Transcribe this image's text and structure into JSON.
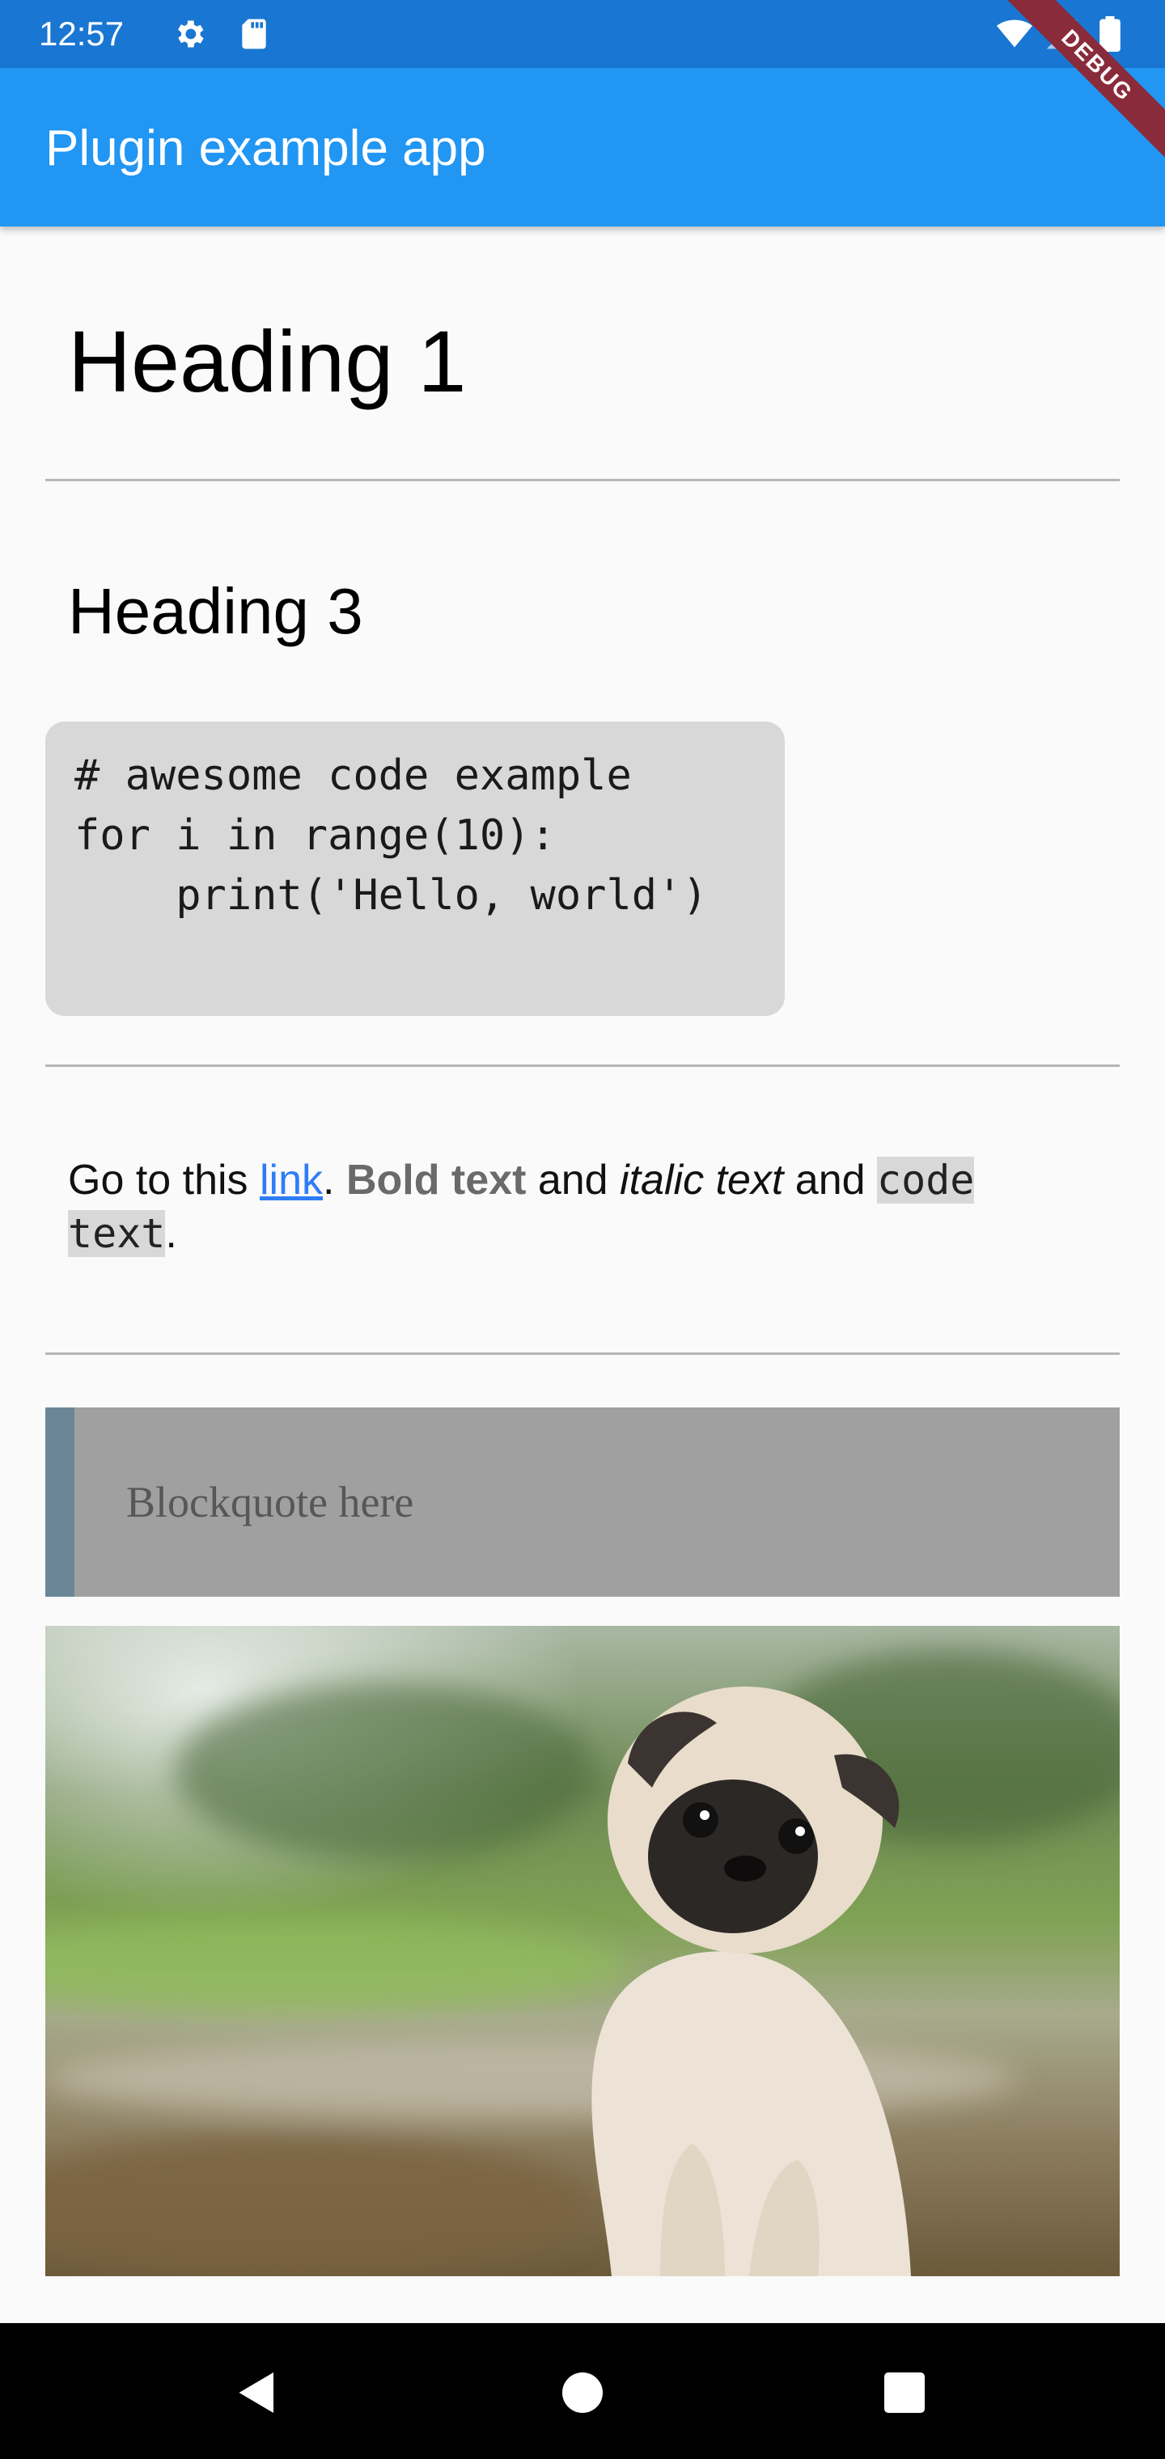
{
  "status_bar": {
    "time": "12:57",
    "icons": [
      "settings-icon",
      "sd-card-icon",
      "wifi-icon",
      "signal-icon",
      "battery-icon"
    ]
  },
  "app_bar": {
    "title": "Plugin example app",
    "debug_banner": "DEBUG"
  },
  "content": {
    "heading1": "Heading 1",
    "heading3": "Heading 3",
    "code_lines": [
      "# awesome code example",
      "for i in range(10):",
      "    print('Hello, world')"
    ],
    "paragraph": {
      "prefix": "Go to this ",
      "link": "link",
      "after_link": ". ",
      "bold": "Bold text",
      "mid1": " and ",
      "italic": "italic text",
      "mid2": " and ",
      "code": "code text",
      "suffix": "."
    },
    "blockquote": "Blockquote here",
    "image_subject": "pug puppy photo"
  },
  "nav_bar": {
    "icons": [
      "back-icon",
      "home-icon",
      "recents-icon"
    ]
  },
  "colors": {
    "status_bar": "#1976d2",
    "app_bar": "#2196f3",
    "link": "#2f7df6",
    "code_bg": "#d8d8d8",
    "blockquote_bg": "#a0a0a0",
    "blockquote_border": "#6b8797",
    "debug_ribbon": "#8a2b3b"
  }
}
